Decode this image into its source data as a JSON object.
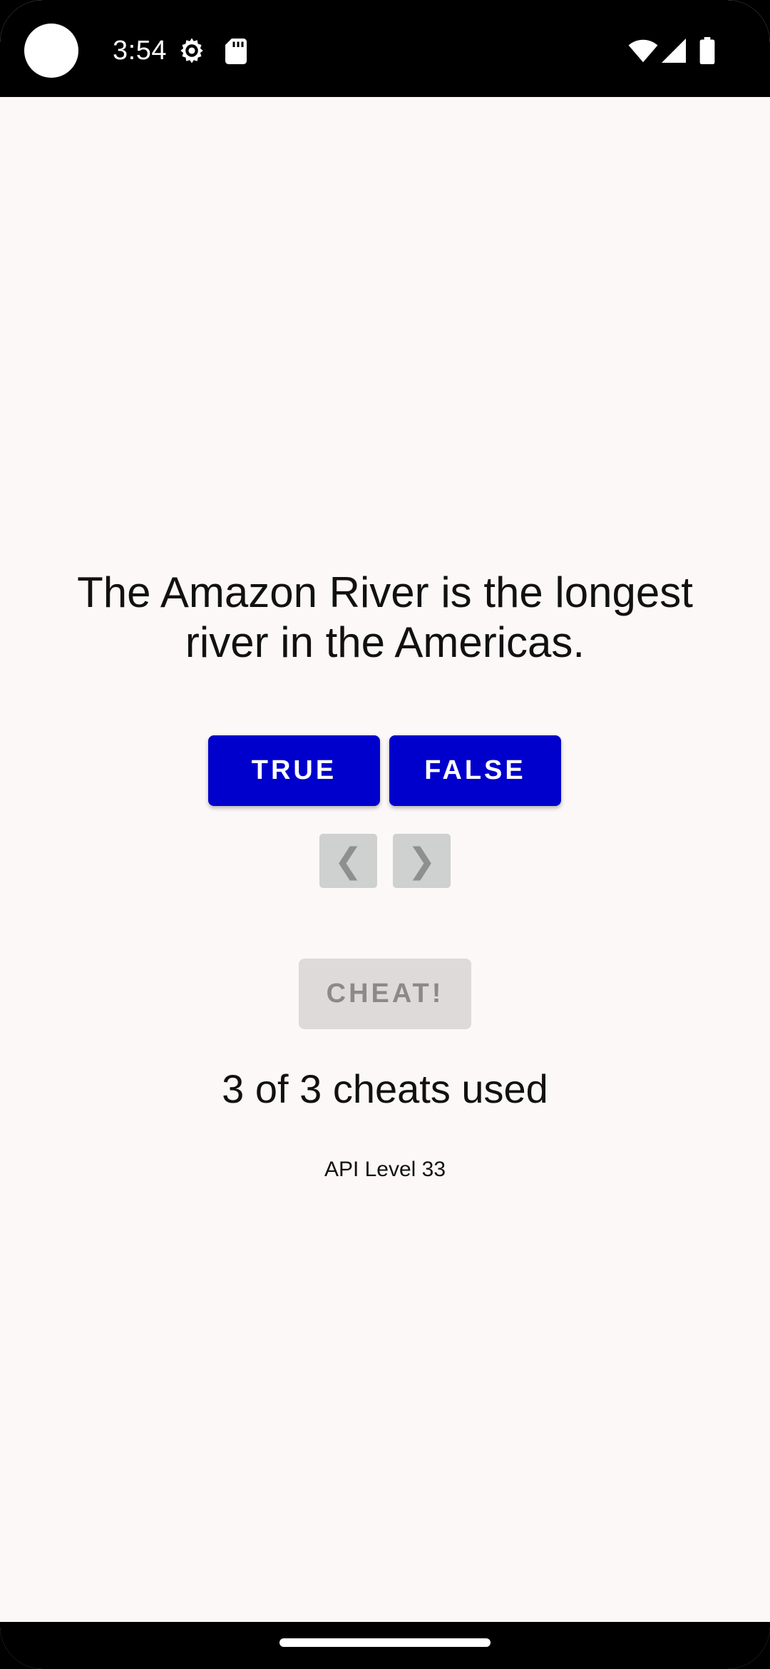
{
  "status_bar": {
    "time": "3:54",
    "icons": [
      "camera-cutout",
      "gear-icon",
      "sd-card-icon",
      "wifi-icon",
      "signal-icon",
      "battery-icon"
    ]
  },
  "question": {
    "text": "The Amazon River is the longest river in the Americas."
  },
  "answers": {
    "true_label": "TRUE",
    "false_label": "FALSE",
    "color": "#0000cc"
  },
  "navigation": {
    "prev_label": "❮",
    "next_label": "❯"
  },
  "cheat": {
    "label": "CHEAT!",
    "enabled": false,
    "status": "3 of 3 cheats used"
  },
  "footer": {
    "api_level": "API Level 33"
  },
  "colors": {
    "background": "#fcf8f7",
    "disabled_button": "#dddad9",
    "nav_button": "#cfd0d0"
  }
}
